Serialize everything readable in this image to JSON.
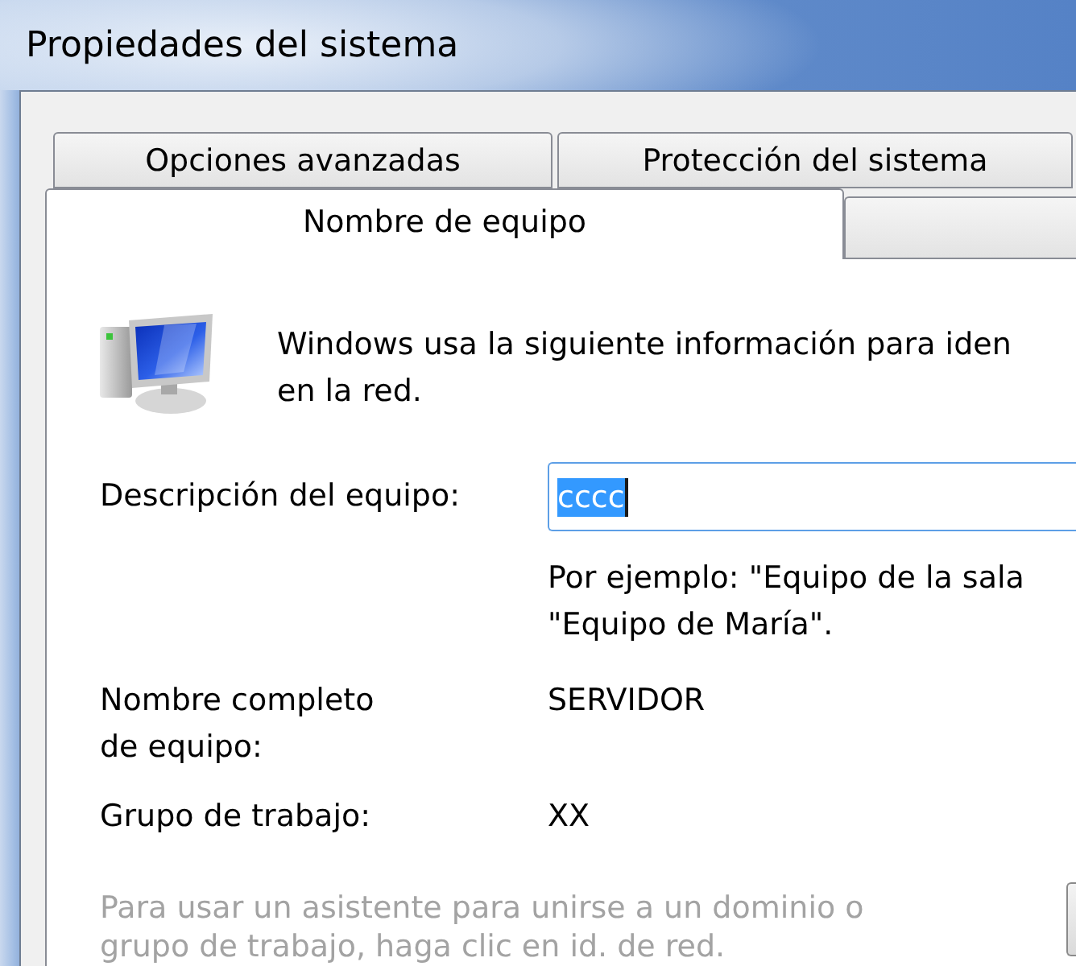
{
  "window": {
    "title": "Propiedades del sistema"
  },
  "tab_rows": [
    {
      "tabs": [
        {
          "label": "Opciones avanzadas",
          "selected": false
        },
        {
          "label": "Protección del sistema",
          "selected": false
        }
      ]
    },
    {
      "tabs": [
        {
          "label": "Nombre de equipo",
          "selected": true
        },
        {
          "selected": false
        }
      ]
    }
  ],
  "intro": {
    "text": "Windows usa la siguiente información para iden\nen la red."
  },
  "description": {
    "label": "Descripción del equipo:",
    "value": "cccc",
    "value_selected": true,
    "focused": true,
    "example": "Por ejemplo: \"Equipo de la sala\n\"Equipo de María\"."
  },
  "info_rows": [
    {
      "label": "Nombre completo\nde equipo:",
      "value": "SERVIDOR"
    },
    {
      "label": "Grupo de trabajo:",
      "value": "XX"
    }
  ],
  "note": {
    "text": "Para usar un asistente para unirse a un dominio o\ngrupo de trabajo, haga clic en id. de red.",
    "disabled": true
  }
}
